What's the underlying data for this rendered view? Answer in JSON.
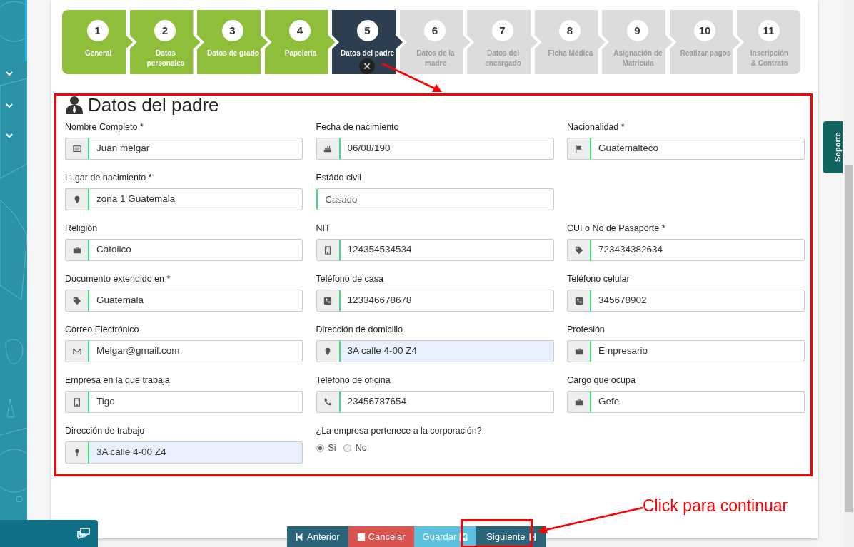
{
  "steps": [
    {
      "number": "1",
      "label": "General",
      "completed": true,
      "selected": false
    },
    {
      "number": "2",
      "label": "Datos personales",
      "completed": true,
      "selected": false
    },
    {
      "number": "3",
      "label": "Datos de grado",
      "completed": true,
      "selected": false
    },
    {
      "number": "4",
      "label": "Papelería",
      "completed": true,
      "selected": false
    },
    {
      "number": "5",
      "label": "Datos del padre",
      "completed": false,
      "selected": true
    },
    {
      "number": "6",
      "label": "Datos de la madre",
      "completed": false,
      "selected": false
    },
    {
      "number": "7",
      "label": "Datos del encargado",
      "completed": false,
      "selected": false
    },
    {
      "number": "8",
      "label": "Ficha Médica",
      "completed": false,
      "selected": false
    },
    {
      "number": "9",
      "label": "Asignación de Matricula",
      "completed": false,
      "selected": false
    },
    {
      "number": "10",
      "label": "Realizar pagos",
      "completed": false,
      "selected": false
    },
    {
      "number": "11",
      "label": "Inscripción & Contrato",
      "completed": false,
      "selected": false
    }
  ],
  "close_button": {
    "label": "×"
  },
  "section_title": "Datos del padre",
  "rows": [
    [
      {
        "label": "Nombre Completo *",
        "value": "Juan melgar",
        "kind": "input",
        "autofilled": false
      },
      {
        "label": "Fecha de nacimiento",
        "value": "06/08/190",
        "kind": "input",
        "autofilled": false
      },
      {
        "label": "Nacionalidad *",
        "value": "Guatemalteco",
        "kind": "input",
        "autofilled": false
      }
    ],
    [
      {
        "label": "Lugar de nacimiento *",
        "value": "zona 1 Guatemala",
        "kind": "input",
        "autofilled": false
      },
      {
        "label": "Estádo civil",
        "value": "Casado",
        "kind": "select",
        "autofilled": false
      }
    ],
    [
      {
        "label": "Religión",
        "value": "Catolico",
        "kind": "input",
        "autofilled": false
      },
      {
        "label": "NIT",
        "value": "124354534534",
        "kind": "input",
        "autofilled": false
      },
      {
        "label": "CUI o No de Pasaporte *",
        "value": "723434382634",
        "kind": "input",
        "autofilled": false
      }
    ],
    [
      {
        "label": "Documento extendido en *",
        "value": "Guatemala",
        "kind": "input",
        "autofilled": false
      },
      {
        "label": "Teléfono de casa",
        "value": "123346678678",
        "kind": "input",
        "autofilled": false
      },
      {
        "label": "Teléfono celular",
        "value": "345678902",
        "kind": "input",
        "autofilled": false
      }
    ],
    [
      {
        "label": "Correo Electrónico",
        "value": "Melgar@gmail.com",
        "kind": "input",
        "autofilled": false
      },
      {
        "label": "Dirección de domicilio",
        "value": "3A calle 4-00 Z4",
        "kind": "input",
        "autofilled": true
      },
      {
        "label": "Profesión",
        "value": "Empresario",
        "kind": "input",
        "autofilled": false
      }
    ],
    [
      {
        "label": "Empresa en la que trabaja",
        "value": "Tigo",
        "kind": "input",
        "autofilled": false
      },
      {
        "label": "Teléfono de oficina",
        "value": "23456787654",
        "kind": "input",
        "autofilled": false
      },
      {
        "label": "Cargo que ocupa",
        "value": "Gefe",
        "kind": "input",
        "autofilled": false
      }
    ],
    [
      {
        "label": "Dirección de trabajo",
        "value": "3A calle 4-00 Z4",
        "kind": "input",
        "autofilled": true
      },
      {
        "label": "¿La empresa pertenece a la corporación?",
        "kind": "radio",
        "options": [
          {
            "label": "Si",
            "selected": true
          },
          {
            "label": "No",
            "selected": false
          }
        ]
      }
    ]
  ],
  "buttons": [
    {
      "label": "Anterior",
      "kind": "prev"
    },
    {
      "label": "Cancelar",
      "kind": "cancel"
    },
    {
      "label": "Guardar",
      "kind": "save"
    },
    {
      "label": "Siguiente",
      "kind": "next"
    }
  ],
  "support_tab": "Soporte",
  "callout": "Click para continuar"
}
